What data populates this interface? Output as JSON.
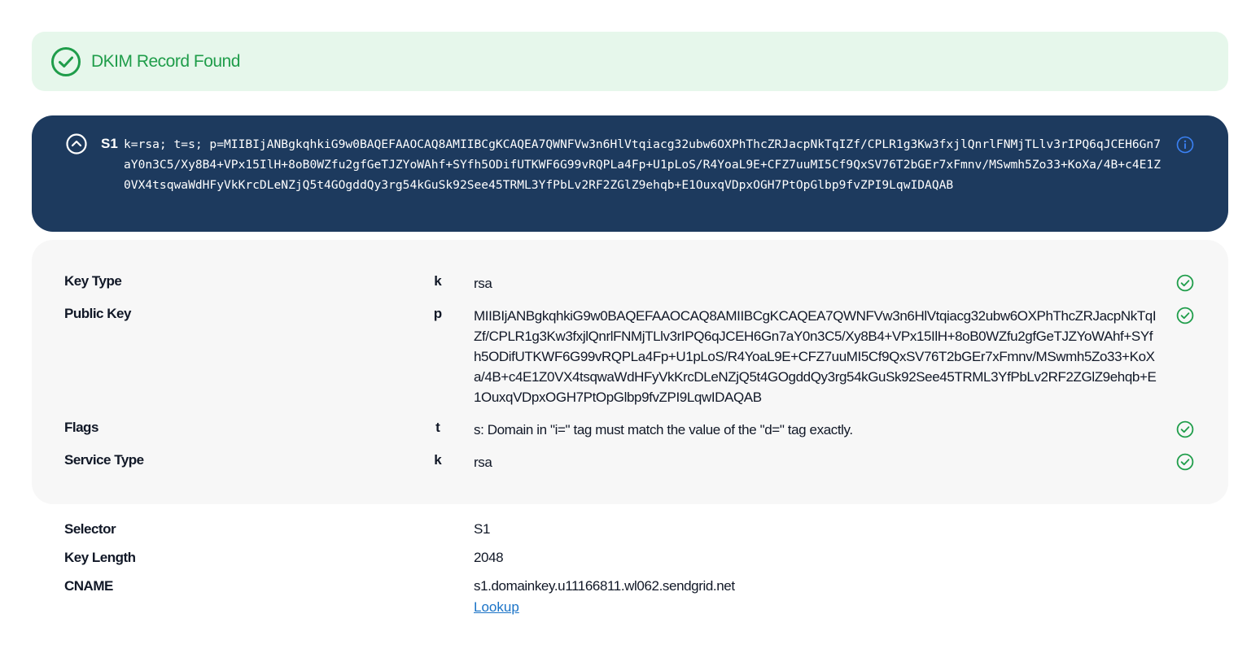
{
  "banner": {
    "title": "DKIM Record Found"
  },
  "record": {
    "selector": "S1",
    "value": "k=rsa; t=s; p=MIIBIjANBgkqhkiG9w0BAQEFAAOCAQ8AMIIBCgKCAQEA7QWNFVw3n6HlVtqiacg32ubw6OXPhThcZRJacpNkTqIZf/CPLR1g3Kw3fxjlQnrlFNMjTLlv3rIPQ6qJCEH6Gn7aY0n3C5/Xy8B4+VPx15IlH+8oB0WZfu2gfGeTJZYoWAhf+SYfh5ODifUTKWF6G99vRQPLa4Fp+U1pLoS/R4YoaL9E+CFZ7uuMI5Cf9QxSV76T2bGEr7xFmnv/MSwmh5Zo33+KoXa/4B+c4E1Z0VX4tsqwaWdHFyVkKrcDLeNZjQ5t4GOgddQy3rg54kGuSk92See45TRML3YfPbLv2RF2ZGlZ9ehqb+E1OuxqVDpxOGH7PtOpGlbp9fvZPI9LqwIDAQAB"
  },
  "details": {
    "rows": [
      {
        "label": "Key Type",
        "tag": "k",
        "value": "rsa"
      },
      {
        "label": "Public Key",
        "tag": "p",
        "value": "MIIBIjANBgkqhkiG9w0BAQEFAAOCAQ8AMIIBCgKCAQEA7QWNFVw3n6HlVtqiacg32ubw6OXPhThcZRJacpNkTqIZf/CPLR1g3Kw3fxjlQnrlFNMjTLlv3rIPQ6qJCEH6Gn7aY0n3C5/Xy8B4+VPx15IlH+8oB0WZfu2gfGeTJZYoWAhf+SYfh5ODifUTKWF6G99vRQPLa4Fp+U1pLoS/R4YoaL9E+CFZ7uuMI5Cf9QxSV76T2bGEr7xFmnv/MSwmh5Zo33+KoXa/4B+c4E1Z0VX4tsqwaWdHFyVkKrcDLeNZjQ5t4GOgddQy3rg54kGuSk92See45TRML3YfPbLv2RF2ZGlZ9ehqb+E1OuxqVDpxOGH7PtOpGlbp9fvZPI9LqwIDAQAB"
      },
      {
        "label": "Flags",
        "tag": "t",
        "value": "s: Domain in \"i=\" tag must match the value of the \"d=\" tag exactly."
      },
      {
        "label": "Service Type",
        "tag": "k",
        "value": "rsa"
      }
    ]
  },
  "info": {
    "selector_label": "Selector",
    "selector_value": "S1",
    "key_length_label": "Key Length",
    "key_length_value": "2048",
    "cname_label": "CNAME",
    "cname_value": "s1.domainkey.u11166811.wl062.sendgrid.net",
    "lookup_label": "Lookup"
  },
  "colors": {
    "success": "#1f9d4a",
    "banner_bg": "#e6f7eb",
    "record_bg": "#1d3a5e",
    "info_icon": "#3b82f6",
    "link": "#1a73c7"
  },
  "icons": {
    "banner": "check-circle-icon",
    "collapse": "chevron-up-circle-icon",
    "info": "info-circle-icon",
    "row_status": "check-circle-icon"
  }
}
